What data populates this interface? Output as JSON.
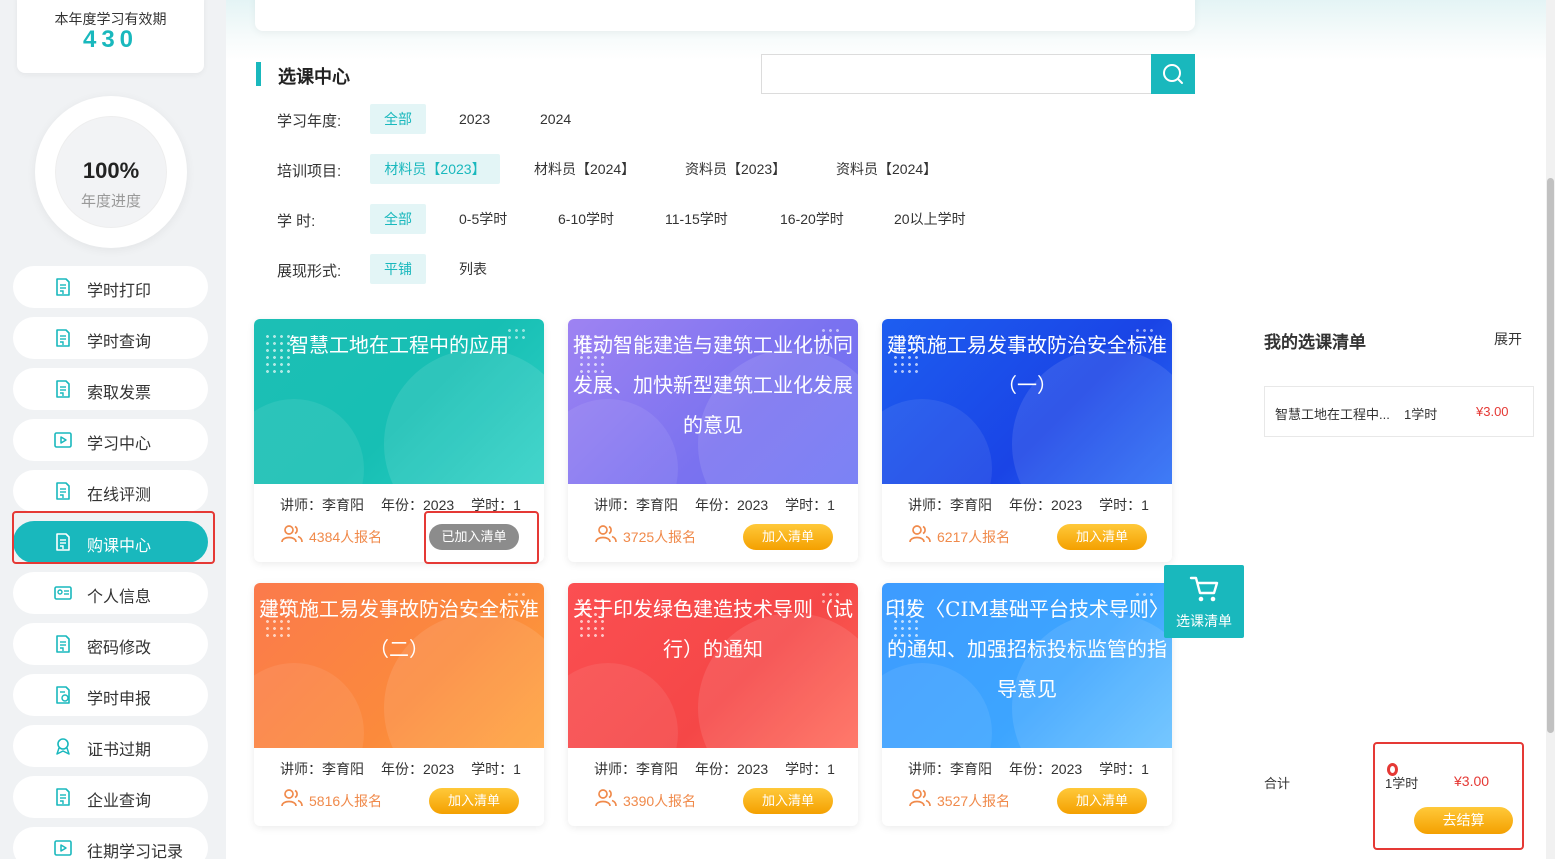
{
  "sidebar": {
    "valid_title": "本年度学习有效期",
    "valid_value": "430",
    "progress_value": "100%",
    "progress_label": "年度进度",
    "items": [
      {
        "label": "学时打印",
        "icon": "document-icon"
      },
      {
        "label": "学时查询",
        "icon": "document-icon"
      },
      {
        "label": "索取发票",
        "icon": "document-icon"
      },
      {
        "label": "学习中心",
        "icon": "play-icon"
      },
      {
        "label": "在线评测",
        "icon": "document-icon"
      },
      {
        "label": "购课中心",
        "icon": "document-icon",
        "active": true
      },
      {
        "label": "个人信息",
        "icon": "id-card-icon"
      },
      {
        "label": "密码修改",
        "icon": "document-icon"
      },
      {
        "label": "学时申报",
        "icon": "clock-document-icon"
      },
      {
        "label": "证书过期",
        "icon": "certificate-icon"
      },
      {
        "label": "企业查询",
        "icon": "document-icon"
      },
      {
        "label": "往期学习记录",
        "icon": "play-icon"
      }
    ]
  },
  "section": {
    "title": "选课中心"
  },
  "search": {
    "placeholder": "",
    "value": ""
  },
  "filters": {
    "year": {
      "label": "学习年度:",
      "options": [
        "全部",
        "2023",
        "2024"
      ],
      "selected": "全部"
    },
    "project": {
      "label": "培训项目:",
      "options": [
        "材料员【2023】",
        "材料员【2024】",
        "资料员【2023】",
        "资料员【2024】"
      ],
      "selected": "材料员【2023】"
    },
    "hours": {
      "label": "学 时:",
      "options": [
        "全部",
        "0-5学时",
        "6-10学时",
        "11-15学时",
        "16-20学时",
        "20以上学时"
      ],
      "selected": "全部"
    },
    "display": {
      "label": "展现形式:",
      "options": [
        "平铺",
        "列表"
      ],
      "selected": "平铺"
    }
  },
  "courses": [
    {
      "title": "智慧工地在工程中的应用",
      "teacher": "讲师：李育阳",
      "year": "年份：2023",
      "hours": "学时：1",
      "enrolled": "4384人报名",
      "button": "已加入清单",
      "added": true
    },
    {
      "title": "推动智能建造与建筑工业化协同发展、加快新型建筑工业化发展的意见",
      "teacher": "讲师：李育阳",
      "year": "年份：2023",
      "hours": "学时：1",
      "enrolled": "3725人报名",
      "button": "加入清单",
      "added": false
    },
    {
      "title": "建筑施工易发事故防治安全标准（一）",
      "teacher": "讲师：李育阳",
      "year": "年份：2023",
      "hours": "学时：1",
      "enrolled": "6217人报名",
      "button": "加入清单",
      "added": false
    },
    {
      "title": "建筑施工易发事故防治安全标准（二）",
      "teacher": "讲师：李育阳",
      "year": "年份：2023",
      "hours": "学时：1",
      "enrolled": "5816人报名",
      "button": "加入清单",
      "added": false
    },
    {
      "title": "关于印发绿色建造技术导则（试行）的通知",
      "teacher": "讲师：李育阳",
      "year": "年份：2023",
      "hours": "学时：1",
      "enrolled": "3390人报名",
      "button": "加入清单",
      "added": false
    },
    {
      "title": "印发〈CIM基础平台技术导则〉的通知、加强招标投标监管的指导意见",
      "teacher": "讲师：李育阳",
      "year": "年份：2023",
      "hours": "学时：1",
      "enrolled": "3527人报名",
      "button": "加入清单",
      "added": false
    }
  ],
  "floating_cart": {
    "label": "选课清单",
    "icon": "cart-icon"
  },
  "cart": {
    "title": "我的选课清单",
    "expand": "展开",
    "items": [
      {
        "name": "智慧工地在工程中...",
        "hours": "1学时",
        "price": "¥3.00"
      }
    ],
    "total_label": "合计",
    "total_hours": "1学时",
    "total_price": "¥3.00",
    "checkout": "去结算"
  },
  "colors": {
    "accent": "#19b8bd",
    "price": "#e53935",
    "button": "#f4a000",
    "annotation": "#e53935"
  }
}
